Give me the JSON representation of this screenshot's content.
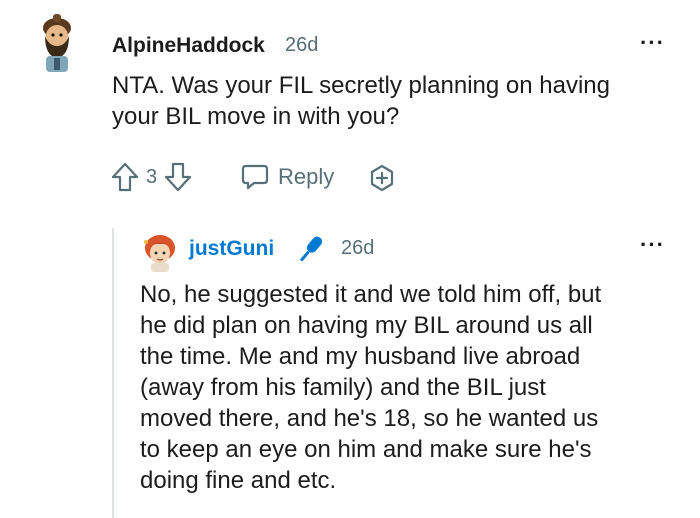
{
  "comment": {
    "author": "AlpineHaddock",
    "age": "26d",
    "text_line1": "NTA. Was your FIL secretly planning on having",
    "text_line2": "your BIL move in with you?",
    "score": "3",
    "reply_label": "Reply",
    "more": "···"
  },
  "reply": {
    "author": "justGuni",
    "age": "26d",
    "lines": [
      "No, he suggested it and we told him off, but",
      "he did plan on having my BIL around us all",
      "the time. Me and my husband live abroad",
      "(away from his family) and the BIL just",
      "moved there, and he's 18, so he wanted us",
      "to keep an eye on him and make sure he's",
      "doing fine and etc."
    ],
    "more": "···"
  },
  "colors": {
    "text": "#1c1c1c",
    "meta": "#576f76",
    "link_blue": "#0079d3",
    "thread": "#dfe3e6"
  },
  "icons": [
    "avatar-alpinehaddock",
    "avatar-justguni",
    "upvote-icon",
    "downvote-icon",
    "comment-bubble-icon",
    "award-plus-icon",
    "microphone-icon"
  ]
}
